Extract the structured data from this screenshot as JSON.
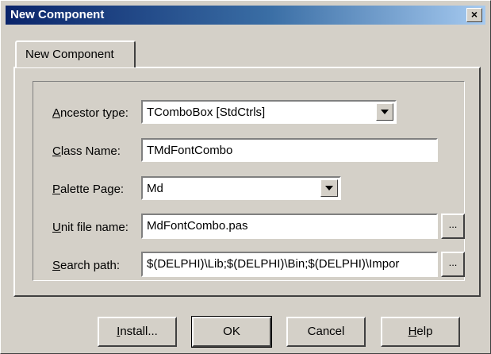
{
  "window": {
    "title": "New Component",
    "close_glyph": "×"
  },
  "tabs": [
    {
      "label": "New Component",
      "selected": true
    }
  ],
  "form": {
    "ancestor_type": {
      "label_mnemonic": "A",
      "label_rest": "ncestor type:",
      "value": "TComboBox  [StdCtrls]"
    },
    "class_name": {
      "label_mnemonic": "C",
      "label_rest": "lass Name:",
      "value": "TMdFontCombo"
    },
    "palette_page": {
      "label_mnemonic": "P",
      "label_rest": "alette Page:",
      "value": "Md"
    },
    "unit_file_name": {
      "label_mnemonic": "U",
      "label_rest": "nit file name:",
      "value": "MdFontCombo.pas",
      "browse_label": "..."
    },
    "search_path": {
      "label_mnemonic": "S",
      "label_rest": "earch path:",
      "value": "$(DELPHI)\\Lib;$(DELPHI)\\Bin;$(DELPHI)\\Impor",
      "browse_label": "..."
    }
  },
  "buttons": {
    "install": {
      "pre": "",
      "mnemonic": "I",
      "post": "nstall..."
    },
    "ok": {
      "label": "OK"
    },
    "cancel": {
      "label": "Cancel"
    },
    "help": {
      "pre": "",
      "mnemonic": "H",
      "post": "elp"
    }
  },
  "icons": {
    "close": "close-icon",
    "dropdown": "chevron-down-icon"
  },
  "colors": {
    "titlebar_start": "#0a246a",
    "titlebar_end": "#a6caf0",
    "face": "#d4d0c8"
  }
}
